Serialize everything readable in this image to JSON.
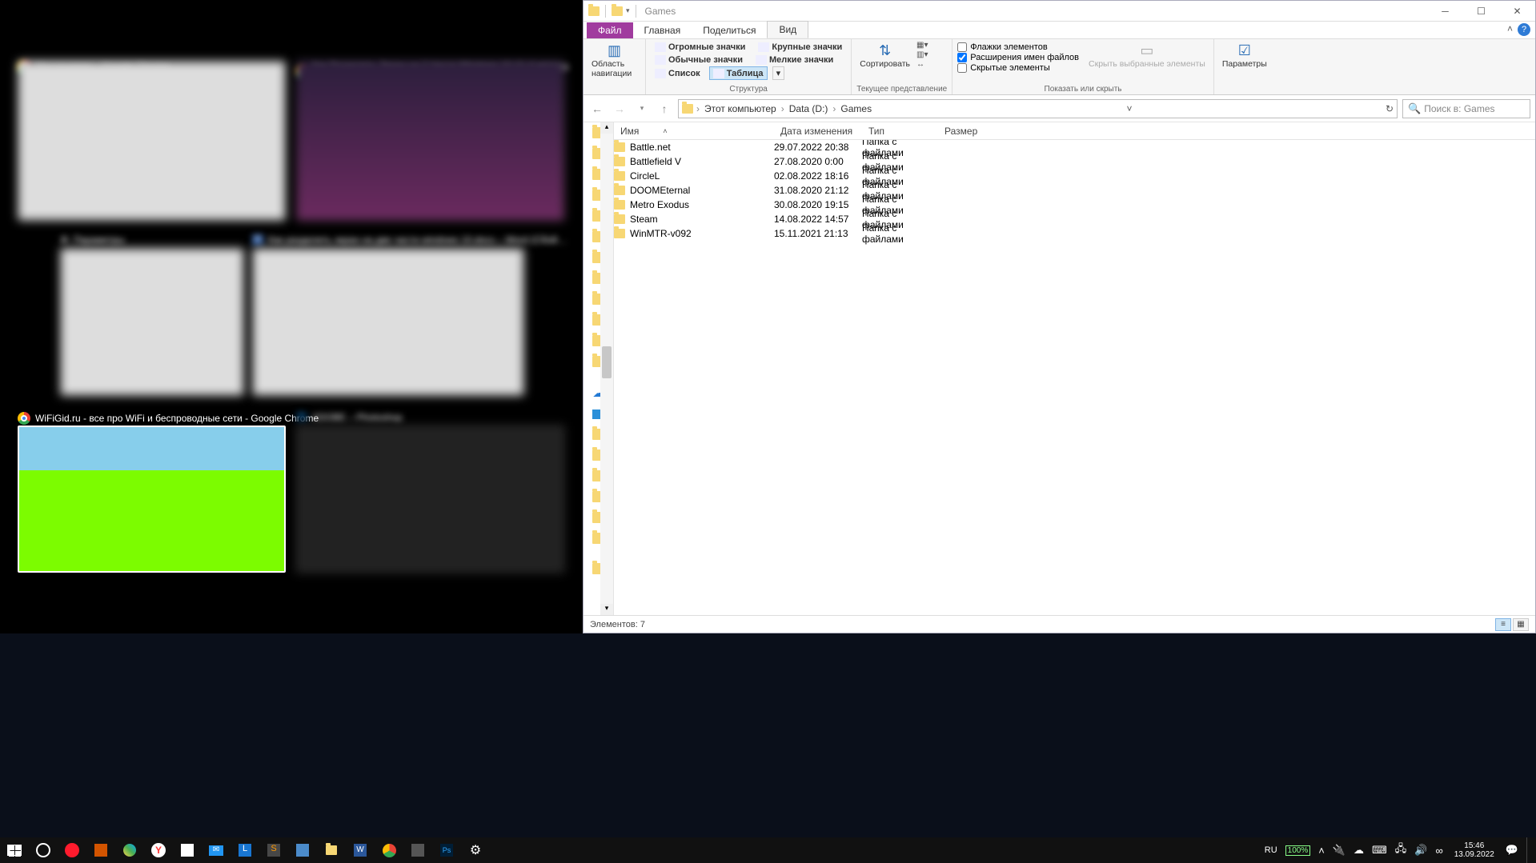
{
  "taskview_thumbs": {
    "w0": "Мессенджер – Google Chrome",
    "w1": "Как Разделить Экран на 2 Части Windows 10 (1)  4 метода ❘❘ Русский",
    "w2": "Параметры",
    "w3": "Как разделить экран на две части windows 10.docx – Word (Сбой…",
    "w4": "WiFiGid.ru - все про WiFi и беспроводные сети - Google Chrome",
    "w5": "ADOBE – Photoshop"
  },
  "explorer": {
    "title": "Games",
    "tabs": {
      "file": "Файл",
      "home": "Главная",
      "share": "Поделиться",
      "view": "Вид"
    },
    "ribbon": {
      "nav_pane": "Область навигации",
      "views": {
        "huge": "Огромные значки",
        "large": "Крупные значки",
        "normal": "Обычные значки",
        "small": "Мелкие значки",
        "list": "Список",
        "table": "Таблица"
      },
      "sort": "Сортировать",
      "checks": {
        "ext": "Флажки элементов",
        "exts": "Расширения имен файлов",
        "hidden": "Скрытые элементы"
      },
      "hide_sel": "Скрыть выбранные элементы",
      "params": "Параметры",
      "grp_struct": "Структура",
      "grp_view": "Текущее представление",
      "grp_show": "Показать или скрыть"
    },
    "breadcrumb": [
      "Этот компьютер",
      "Data (D:)",
      "Games"
    ],
    "search_placeholder": "Поиск в: Games",
    "columns": {
      "name": "Имя",
      "date": "Дата изменения",
      "type": "Тип",
      "size": "Размер"
    },
    "rows": [
      {
        "name": "Battle.net",
        "date": "29.07.2022 20:38",
        "type": "Папка с файлами"
      },
      {
        "name": "Battlefield V",
        "date": "27.08.2020 0:00",
        "type": "Папка с файлами"
      },
      {
        "name": "CircleL",
        "date": "02.08.2022 18:16",
        "type": "Папка с файлами"
      },
      {
        "name": "DOOMEternal",
        "date": "31.08.2020 21:12",
        "type": "Папка с файлами"
      },
      {
        "name": "Metro Exodus",
        "date": "30.08.2020 19:15",
        "type": "Папка с файлами"
      },
      {
        "name": "Steam",
        "date": "14.08.2022 14:57",
        "type": "Папка с файлами"
      },
      {
        "name": "WinMTR-v092",
        "date": "15.11.2021 21:13",
        "type": "Папка с файлами"
      }
    ],
    "status": "Элементов: 7"
  },
  "tray": {
    "lang": "RU",
    "battery": "100%",
    "time": "15:46",
    "date": "13.09.2022"
  }
}
